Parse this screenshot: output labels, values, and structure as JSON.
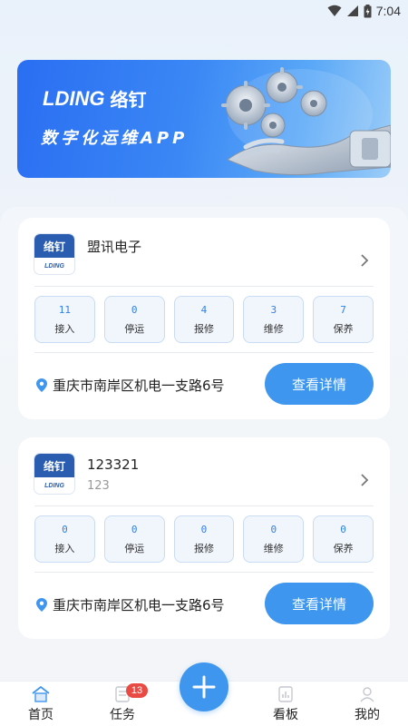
{
  "status_bar": {
    "time": "7:04"
  },
  "banner": {
    "logo_en": "LDING",
    "logo_cn": "络钉",
    "subtitle": "数字化运维APP"
  },
  "devices": [
    {
      "logo_cn": "络钉",
      "logo_en": "LDING",
      "name": "盟讯电子",
      "code": "",
      "stats": [
        {
          "label": "接入",
          "value": "11"
        },
        {
          "label": "停运",
          "value": "0"
        },
        {
          "label": "报修",
          "value": "4"
        },
        {
          "label": "维修",
          "value": "3"
        },
        {
          "label": "保养",
          "value": "7"
        }
      ],
      "address": "重庆市南岸区机电一支路6号",
      "detail_button": "查看详情"
    },
    {
      "logo_cn": "络钉",
      "logo_en": "LDING",
      "name": "123321",
      "code": "123",
      "stats": [
        {
          "label": "接入",
          "value": "0"
        },
        {
          "label": "停运",
          "value": "0"
        },
        {
          "label": "报修",
          "value": "0"
        },
        {
          "label": "维修",
          "value": "0"
        },
        {
          "label": "保养",
          "value": "0"
        }
      ],
      "address": "重庆市南岸区机电一支路6号",
      "detail_button": "查看详情"
    }
  ],
  "bottom_nav": {
    "items": [
      {
        "label": "首页",
        "icon": "home-icon"
      },
      {
        "label": "任务",
        "icon": "task-icon",
        "badge": "13"
      },
      {
        "label": "看板",
        "icon": "dashboard-icon"
      },
      {
        "label": "我的",
        "icon": "profile-icon"
      }
    ],
    "fab_icon": "plus-icon"
  },
  "colors": {
    "accent": "#3f96ee",
    "stat_value": "#2f7fe6",
    "badge": "#e94b44"
  }
}
